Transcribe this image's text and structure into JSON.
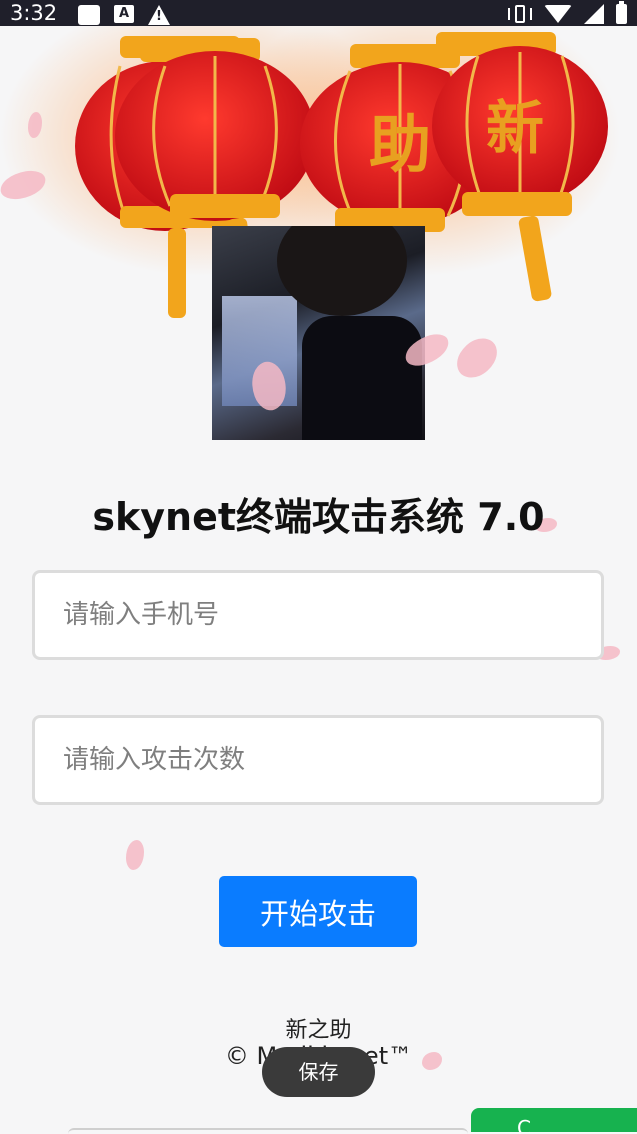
{
  "status_bar": {
    "time": "3:32",
    "a_icon": "A"
  },
  "banner": {
    "lanterns": [
      {
        "char": "",
        "color": "#d9161c"
      },
      {
        "char": "",
        "color": "#d9161c"
      },
      {
        "char": "助",
        "color": "#d9161c"
      },
      {
        "char": "新",
        "color": "#d9161c"
      }
    ],
    "accent_gold": "#f2a51c"
  },
  "main": {
    "title": "skynet终端攻击系统 7.0",
    "phone_placeholder": "请输入手机号",
    "count_placeholder": "请输入攻击次数",
    "start_button": "开始攻击",
    "button_color": "#0a7cff"
  },
  "footer": {
    "line1": "新之助",
    "line2": "© Madi                kynet™"
  },
  "toast": {
    "text": "保存"
  },
  "floating_button": {
    "text": "C",
    "color": "#17b24f"
  }
}
